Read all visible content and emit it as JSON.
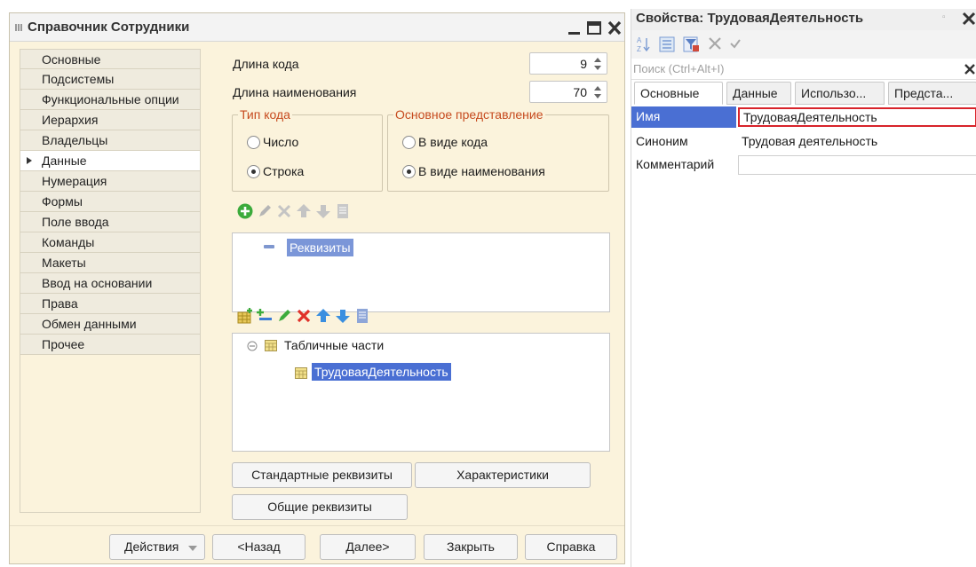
{
  "window": {
    "title": "Справочник Сотрудники"
  },
  "nav": {
    "items": [
      {
        "label": "Основные"
      },
      {
        "label": "Подсистемы"
      },
      {
        "label": "Функциональные опции"
      },
      {
        "label": "Иерархия"
      },
      {
        "label": "Владельцы"
      },
      {
        "label": "Данные"
      },
      {
        "label": "Нумерация"
      },
      {
        "label": "Формы"
      },
      {
        "label": "Поле ввода"
      },
      {
        "label": "Команды"
      },
      {
        "label": "Макеты"
      },
      {
        "label": "Ввод на основании"
      },
      {
        "label": "Права"
      },
      {
        "label": "Обмен данными"
      },
      {
        "label": "Прочее"
      }
    ],
    "active": "Данные"
  },
  "form": {
    "code_length_label": "Длина кода",
    "code_length_value": "9",
    "name_length_label": "Длина наименования",
    "name_length_value": "70",
    "code_type": {
      "title": "Тип кода",
      "option_number": "Число",
      "option_string": "Строка",
      "selected": "Строка"
    },
    "main_presentation": {
      "title": "Основное представление",
      "option_code": "В виде кода",
      "option_name": "В виде наименования",
      "selected": "В виде наименования"
    },
    "attributes_tree": {
      "root_label": "Реквизиты"
    },
    "tabular_tree": {
      "root_label": "Табличные части",
      "child_label": "ТрудоваяДеятельность"
    },
    "standard_attributes_button": "Стандартные реквизиты",
    "characteristics_button": "Характеристики",
    "common_attributes_button": "Общие реквизиты"
  },
  "footer": {
    "actions_label": "Действия",
    "back_label": "<Назад",
    "next_label": "Далее>",
    "close_label": "Закрыть",
    "help_label": "Справка"
  },
  "properties": {
    "title": "Свойства: ТрудоваяДеятельность",
    "search_placeholder": "Поиск (Ctrl+Alt+I)",
    "tabs": [
      {
        "label": "Основные"
      },
      {
        "label": "Данные"
      },
      {
        "label": "Использо..."
      },
      {
        "label": "Предста..."
      }
    ],
    "active_tab": "Основные",
    "rows": [
      {
        "name": "Имя",
        "value": "ТрудоваяДеятельность"
      },
      {
        "name": "Синоним",
        "value": "Трудовая деятельность"
      },
      {
        "name": "Комментарий",
        "value": ""
      }
    ]
  },
  "colors": {
    "form_background": "#fbf3dc",
    "group_title": "#c64a1e",
    "selection": "#4a6fd3",
    "add_icon_green": "#3cab3c",
    "delete_icon_red": "#e0312a",
    "focus_border": "#d8232a"
  }
}
